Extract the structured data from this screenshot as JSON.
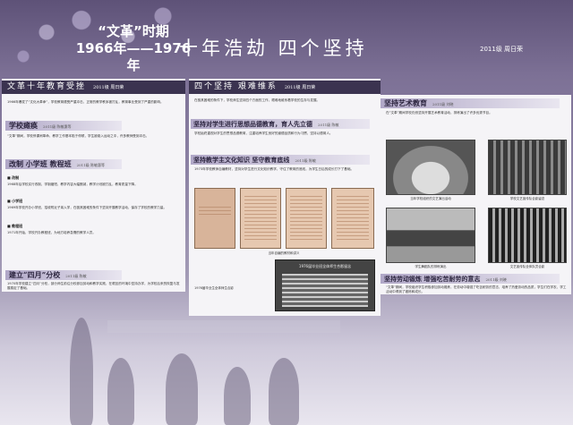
{
  "header": {
    "era_label": "“文革”时期",
    "years": "1966年——1976年",
    "main_title": "十年浩劫 四个坚持",
    "credit": "2011级 周日荣"
  },
  "left_panel": {
    "title": "文革十年教育受挫",
    "title_tag": "2011级 周日荣",
    "intro": "1966年爆发了“文化大革命”，学校教育遭受严重冲击，正常的教学秩序被打乱，教育事业受到了严重的影响。",
    "section1_title": "学校瘫痪",
    "section1_tag": "2011级 陈敏惠等",
    "section1_body": "“文革”期间，学校停课闹革命，教学工作基本陷于停顿，学生被卷入运动之中，许多教师受到冲击。",
    "section2_title": "改制 小学班 教程班",
    "section2_tag": "2011级 陈敏惠等",
    "label_a": "■ 改制",
    "body_a": "1968年后学校实行改制，学制缩短，教学内容大幅删减，教学计划被打乱，教育质量下降。",
    "label_b": "■ 小学班",
    "body_b": "1969年学校开办小学班，招收附近子弟入学，在极其困难的条件下坚持开展教学活动，保存了学校的教学力量。",
    "label_c": "■ 教程班",
    "body_c": "1971年开始，学校开办教程班，为地方培养急需的教学人员。",
    "section3_title": "建立“四月”分校",
    "section3_tag": "2011级 陈敏",
    "section3_body": "1970年学校建立“四月”分校，部分师生前往分校参加劳动和教学实践，在艰苦的环境中坚持办学，为学校后来的恢复与发展奠定了基础。"
  },
  "mid_panel": {
    "title": "四个坚持 艰难维系",
    "title_tag": "2011级 周日荣",
    "intro": "在极其困难的条件下，学校师生坚持四个方面的工作，艰难地维系着学校的生存与发展。",
    "sub1_title": "坚持对学生进行思想品德教育，育人先立德",
    "sub1_tag": "2011级 陈敏",
    "sub1_body": "学校始终重视对学生的思想品德教育，注重培养学生良好的道德品质和行为习惯，坚持以德育人。",
    "sub2_title": "坚持教学主文化知识 坚守教育底线",
    "sub2_tag": "2011级 陈敏",
    "sub2_body": "1973年学校教师自编教材，坚持对学生进行文化知识教学，守住了教育的底线，为学生日后的成长打下了基础。",
    "caption_docs": "当年自编的教材和讲义",
    "group_photo_banner": "1976届毕业班全体师生合影留念",
    "group_caption": "1976届毕业生全体师生合影"
  },
  "right_panel": {
    "sub1_title": "坚持艺术教育",
    "sub1_tag": "2011级 刘晓",
    "sub1_body": "在“文革”期间学校仍然坚持开展艺术教育活动，排练演出了许多优秀节目。",
    "caption1": "当年学校组织的文艺演出活动",
    "caption2": "学校文艺宣传队合影留念",
    "caption3": "学生舞蹈队的排练演出",
    "caption4": "文艺宣传队全体队员合影",
    "sub2_title": "坚持劳动锻炼 增强吃苦耐劳的意志",
    "sub2_tag": "2011级 刘晓",
    "sub2_body": "“文革”期间，学校组织学生积极参加劳动锻炼，在劳动中增强了吃苦耐劳的意志，培养了热爱劳动的品质，学生们在学农、学工活动中得到了锻炼和成长。"
  },
  "colors": {
    "background_top": "#5e5278",
    "panel_bar": "#3b3350",
    "panel_bg": "#f5f4f7"
  }
}
